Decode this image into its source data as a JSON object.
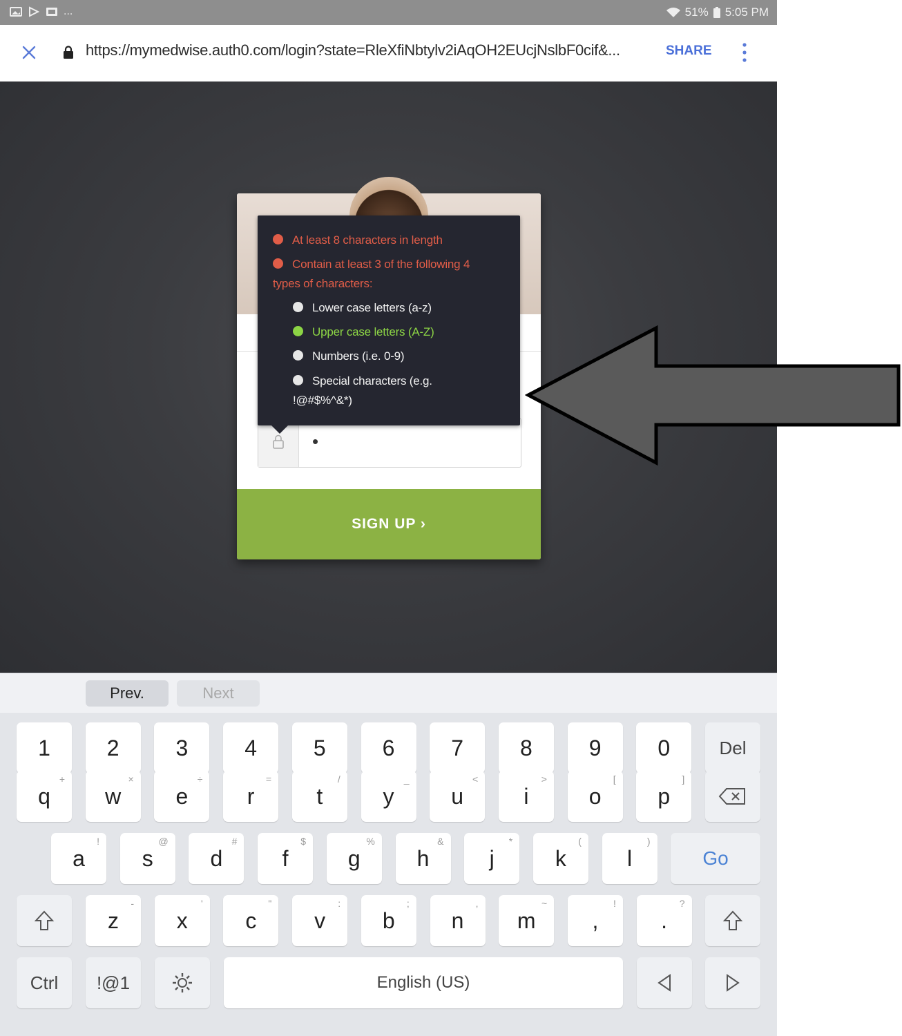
{
  "status_bar": {
    "notification_icons": [
      "image-icon",
      "play-icon",
      "gallery-icon"
    ],
    "overflow": "...",
    "battery": "51%",
    "time": "5:05 PM"
  },
  "browser": {
    "url": "https://mymedwise.auth0.com/login?state=RleXfiNbtylv2iAqOH2EUcjNslbF0cif&...",
    "share_label": "SHARE"
  },
  "password_tooltip": {
    "rule_length": "At least 8 characters in length",
    "rule_types_line1": "Contain at least 3 of the following 4",
    "rule_types_line2": "types of characters:",
    "lower": "Lower case letters (a-z)",
    "upper": "Upper case letters (A-Z)",
    "numbers": "Numbers (i.e. 0-9)",
    "special_line1": "Special characters (e.g.",
    "special_line2": "!@#$%^&*)"
  },
  "form": {
    "password_value": "•",
    "signup_label": "SIGN UP ›"
  },
  "keyboard": {
    "prev_label": "Prev.",
    "next_label": "Next",
    "numbers_row": [
      "1",
      "2",
      "3",
      "4",
      "5",
      "6",
      "7",
      "8",
      "9",
      "0"
    ],
    "del_label": "Del",
    "row1": [
      {
        "k": "q",
        "h": "+"
      },
      {
        "k": "w",
        "h": "×"
      },
      {
        "k": "e",
        "h": "÷"
      },
      {
        "k": "r",
        "h": "="
      },
      {
        "k": "t",
        "h": "/"
      },
      {
        "k": "y",
        "h": "_"
      },
      {
        "k": "u",
        "h": "<"
      },
      {
        "k": "i",
        "h": ">"
      },
      {
        "k": "o",
        "h": "["
      },
      {
        "k": "p",
        "h": "]"
      }
    ],
    "row2": [
      {
        "k": "a",
        "h": "!"
      },
      {
        "k": "s",
        "h": "@"
      },
      {
        "k": "d",
        "h": "#"
      },
      {
        "k": "f",
        "h": "$"
      },
      {
        "k": "g",
        "h": "%"
      },
      {
        "k": "h",
        "h": "&"
      },
      {
        "k": "j",
        "h": "*"
      },
      {
        "k": "k",
        "h": "("
      },
      {
        "k": "l",
        "h": ")"
      }
    ],
    "go_label": "Go",
    "row3": [
      {
        "k": "z",
        "h": "-"
      },
      {
        "k": "x",
        "h": "'"
      },
      {
        "k": "c",
        "h": "\""
      },
      {
        "k": "v",
        "h": ":"
      },
      {
        "k": "b",
        "h": ";"
      },
      {
        "k": "n",
        "h": ","
      },
      {
        "k": "m",
        "h": "~"
      },
      {
        "k": ",",
        "h": "!"
      },
      {
        "k": ".",
        "h": "?"
      }
    ],
    "ctrl_label": "Ctrl",
    "sym_label": "!@1",
    "space_label": "English (US)"
  }
}
